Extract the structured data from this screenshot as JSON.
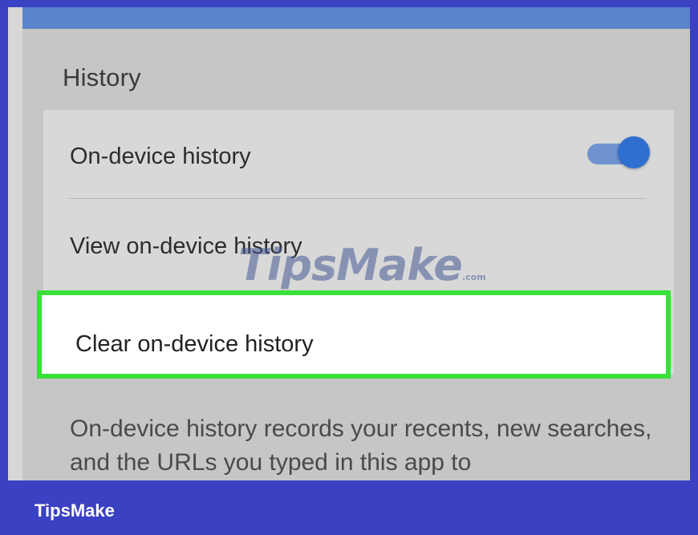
{
  "history": {
    "title": "History",
    "rows": [
      {
        "label": "On-device history",
        "toggle": {
          "on": true
        }
      },
      {
        "label": "View on-device history"
      },
      {
        "label": "Clear on-device history"
      }
    ],
    "description": "On-device history records your recents, new searches, and the URLs you typed in this app to"
  },
  "watermark": {
    "text": "TipsMake",
    "suffix": ".com"
  },
  "footer": {
    "brand": "TipsMake"
  },
  "colors": {
    "frame": "#3b41c3",
    "toggle_on": "#2f6fd0",
    "highlight_border": "#39e03a"
  },
  "icons": {
    "toggle": "toggle-switch-on"
  }
}
